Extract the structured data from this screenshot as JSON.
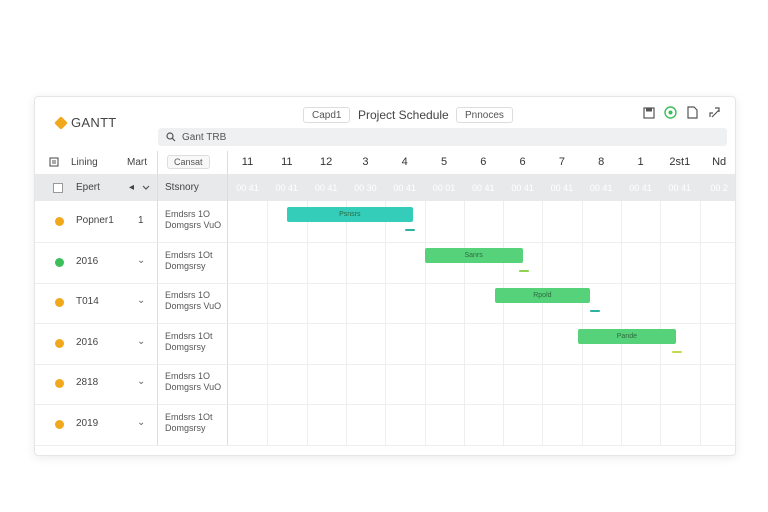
{
  "app": {
    "logo": "GANTT",
    "title": "Project Schedule",
    "left_button": "Capd1",
    "right_button": "Pnnoces"
  },
  "toolbar_icons": [
    "save-icon",
    "globe-icon",
    "document-icon",
    "share-icon"
  ],
  "search": {
    "value": "Gant TRB"
  },
  "header": {
    "tab_listing": "Lining",
    "tab_mart": "Mart",
    "button_cansat": "Cansat",
    "days": [
      "11",
      "11",
      "12",
      "3",
      "4",
      "5",
      "6",
      "6",
      "7",
      "8",
      "1",
      "2st1",
      "Nd"
    ],
    "col_event": "Epert",
    "col_summary": "Stsnory",
    "sort_arrow": "◂",
    "sub_labels": [
      "00 41",
      "00 41",
      "00 41",
      "00 30",
      "00 41",
      "00 01",
      "00 41",
      "00 41",
      "00 41",
      "00 41",
      "00 41",
      "00 41",
      "00 2"
    ]
  },
  "rows": [
    {
      "name": "Popner1",
      "marker": "1",
      "status_color": "#f2a81d",
      "desc1": "Emdsrs 1O",
      "desc2": "Domgsrs VuO"
    },
    {
      "name": "2016",
      "marker": "⌄",
      "status_color": "#3cbf5a",
      "desc1": "Emdsrs 1Ot",
      "desc2": "Domgsrsy"
    },
    {
      "name": "T014",
      "marker": "⌄",
      "status_color": "#f2a81d",
      "desc1": "Emdsrs 1O",
      "desc2": "Domgsrs VuO"
    },
    {
      "name": "2016",
      "marker": "⌄",
      "status_color": "#f2a81d",
      "desc1": "Emdsrs 1Ot",
      "desc2": "Domgsrsy"
    },
    {
      "name": "2818",
      "marker": "⌄",
      "status_color": "#f2a81d",
      "desc1": "Emdsrs 1O",
      "desc2": "Domgsrs VuO"
    },
    {
      "name": "2019",
      "marker": "⌄",
      "status_color": "#f2a81d",
      "desc1": "Emdsrs 1Ot",
      "desc2": "Domgsrsy"
    }
  ],
  "bars": [
    {
      "label": "Psnsrs",
      "row": 0,
      "start_col": 1.5,
      "span": 3.2,
      "color": "#34cdb9"
    },
    {
      "label": "Sanrs",
      "row": 1,
      "start_col": 5.0,
      "span": 2.5,
      "color": "#56d27a"
    },
    {
      "label": "Rpold",
      "row": 2,
      "start_col": 6.8,
      "span": 2.4,
      "color": "#56d27a"
    },
    {
      "label": "Pande",
      "row": 3,
      "start_col": 8.9,
      "span": 2.5,
      "color": "#56d27a"
    }
  ],
  "ticks": [
    {
      "row": 0,
      "col": 4.5,
      "color": "#2bb39f"
    },
    {
      "row": 1,
      "col": 7.4,
      "color": "#8ed34d"
    },
    {
      "row": 2,
      "col": 9.2,
      "color": "#2bb39f"
    },
    {
      "row": 3,
      "col": 11.3,
      "color": "#c6d94a"
    }
  ]
}
